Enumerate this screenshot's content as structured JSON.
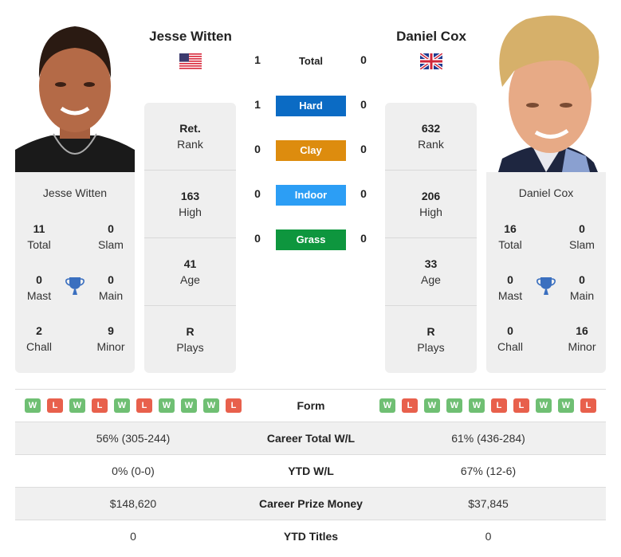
{
  "colors": {
    "hard": "#0B6BC4",
    "clay": "#DD8C0E",
    "indoor": "#2C9EF5",
    "grass": "#0E963E",
    "win": "#6FBF73",
    "loss": "#E8604C",
    "trophy": "#3A6FBF"
  },
  "player1": {
    "name": "Jesse Witten",
    "flag": "us-flag",
    "rank": {
      "value": "Ret.",
      "label": "Rank"
    },
    "high": {
      "value": "163",
      "label": "High"
    },
    "age": {
      "value": "41",
      "label": "Age"
    },
    "plays": {
      "value": "R",
      "label": "Plays"
    },
    "titles": {
      "total": {
        "value": "11",
        "label": "Total"
      },
      "slam": {
        "value": "0",
        "label": "Slam"
      },
      "mast": {
        "value": "0",
        "label": "Mast"
      },
      "main": {
        "value": "0",
        "label": "Main"
      },
      "chall": {
        "value": "2",
        "label": "Chall"
      },
      "minor": {
        "value": "9",
        "label": "Minor"
      }
    },
    "form": [
      "W",
      "L",
      "W",
      "L",
      "W",
      "L",
      "W",
      "W",
      "W",
      "L"
    ]
  },
  "player2": {
    "name": "Daniel Cox",
    "flag": "uk-flag",
    "rank": {
      "value": "632",
      "label": "Rank"
    },
    "high": {
      "value": "206",
      "label": "High"
    },
    "age": {
      "value": "33",
      "label": "Age"
    },
    "plays": {
      "value": "R",
      "label": "Plays"
    },
    "titles": {
      "total": {
        "value": "16",
        "label": "Total"
      },
      "slam": {
        "value": "0",
        "label": "Slam"
      },
      "mast": {
        "value": "0",
        "label": "Mast"
      },
      "main": {
        "value": "0",
        "label": "Main"
      },
      "chall": {
        "value": "0",
        "label": "Chall"
      },
      "minor": {
        "value": "16",
        "label": "Minor"
      }
    },
    "form": [
      "W",
      "L",
      "W",
      "W",
      "W",
      "L",
      "L",
      "W",
      "W",
      "L"
    ]
  },
  "h2h": {
    "total": {
      "label": "Total",
      "p1": "1",
      "p2": "0"
    },
    "hard": {
      "label": "Hard",
      "p1": "1",
      "p2": "0"
    },
    "clay": {
      "label": "Clay",
      "p1": "0",
      "p2": "0"
    },
    "indoor": {
      "label": "Indoor",
      "p1": "0",
      "p2": "0"
    },
    "grass": {
      "label": "Grass",
      "p1": "0",
      "p2": "0"
    }
  },
  "table": {
    "form_label": "Form",
    "rows": [
      {
        "label": "Career Total W/L",
        "p1": "56% (305-244)",
        "p2": "61% (436-284)"
      },
      {
        "label": "YTD W/L",
        "p1": "0% (0-0)",
        "p2": "67% (12-6)"
      },
      {
        "label": "Career Prize Money",
        "p1": "$148,620",
        "p2": "$37,845"
      },
      {
        "label": "YTD Titles",
        "p1": "0",
        "p2": "0"
      }
    ]
  }
}
